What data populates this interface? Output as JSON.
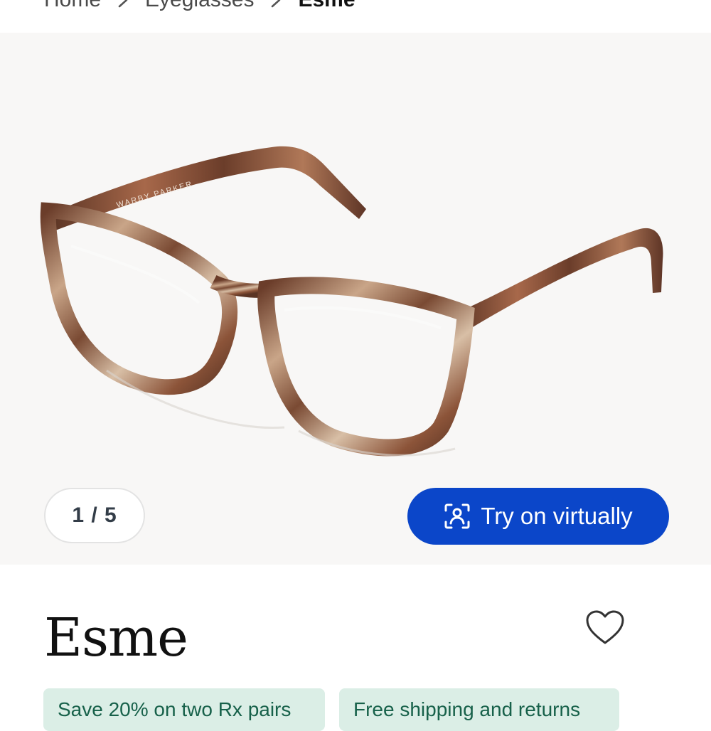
{
  "breadcrumb": {
    "items": [
      "Home",
      "Eyeglasses",
      "Esme"
    ]
  },
  "gallery": {
    "counter": "1 / 5",
    "try_on_label": "Try on virtually",
    "frame_engraving": "WARBY PARKER"
  },
  "product": {
    "name": "Esme"
  },
  "promos": [
    "Save 20% on two Rx pairs",
    "Free shipping and returns"
  ],
  "colors": {
    "accent": "#0b46c9",
    "promo_bg": "#dbeee6",
    "promo_text": "#17614a",
    "tortoise_dark": "#5a3424",
    "tortoise_light": "#c9a588"
  },
  "icons": {
    "breadcrumb_separator": "chevron-right-icon",
    "try_on": "face-scan-icon",
    "favorite": "heart-outline-icon"
  }
}
